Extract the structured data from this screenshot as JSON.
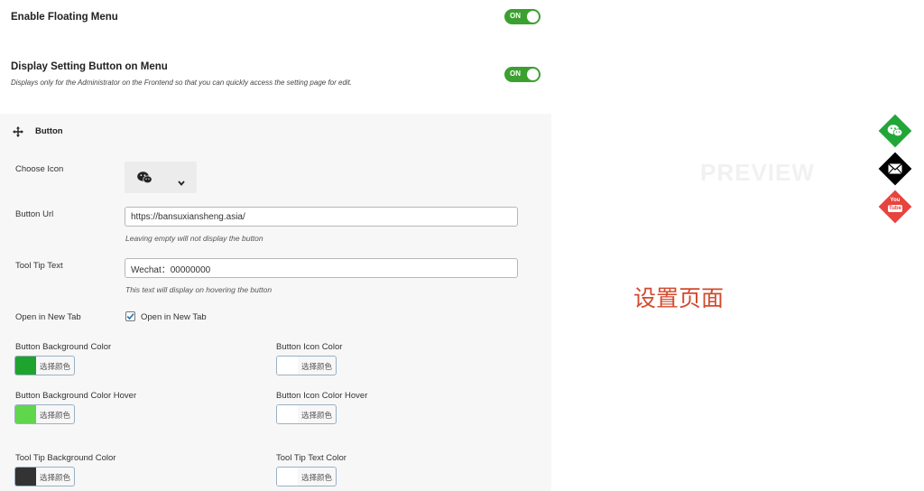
{
  "settings": {
    "floating": {
      "title": "Enable Floating Menu",
      "toggle": "ON"
    },
    "setting_button": {
      "title": "Display Setting Button on Menu",
      "desc": "Displays only for the Administrator on the Frontend so that you can quickly access the setting page for edit.",
      "toggle": "ON"
    }
  },
  "panel": {
    "header": "Button",
    "choose_icon": {
      "label": "Choose Icon",
      "icon": "wechat-icon"
    },
    "button_url": {
      "label": "Button Url",
      "value": "https://bansuxiansheng.asia/",
      "hint": "Leaving empty will not display the button"
    },
    "tooltip": {
      "label": "Tool Tip Text",
      "value": "Wechat：00000000",
      "hint": "This text will display on hovering the button"
    },
    "new_tab": {
      "label": "Open in New Tab",
      "checkbox_label": "Open in New Tab",
      "checked": true
    },
    "colors": {
      "choose_text": "选择颜色",
      "bg": {
        "label": "Button Background Color",
        "value": "#1fa32f"
      },
      "icon": {
        "label": "Button Icon Color",
        "value": "#ffffff"
      },
      "bg_hover": {
        "label": "Button Background Color Hover",
        "value": "#5fd64b"
      },
      "icon_hover": {
        "label": "Button Icon Color Hover",
        "value": "#ffffff"
      },
      "tip_bg": {
        "label": "Tool Tip Background Color",
        "value": "#333333"
      },
      "tip_text": {
        "label": "Tool Tip Text Color",
        "value": "#ffffff"
      }
    }
  },
  "preview": {
    "watermark": "PREVIEW",
    "caption": "设置页面",
    "buttons": [
      {
        "name": "wechat-icon",
        "color": "#22a638"
      },
      {
        "name": "mail-icon",
        "color": "#000000"
      },
      {
        "name": "youtube-icon",
        "color": "#e8433d",
        "text_top": "You",
        "text_bottom": "Tube"
      }
    ]
  }
}
